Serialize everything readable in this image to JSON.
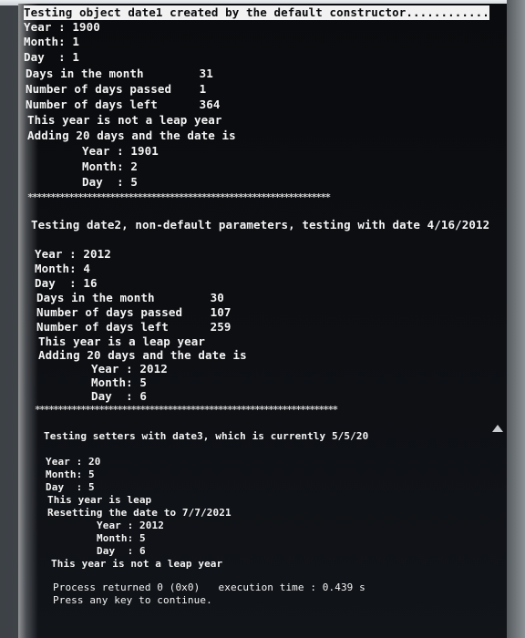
{
  "console": {
    "section1": {
      "header": "Testing object date1 created by the default constructor............",
      "year": "Year : 1900",
      "month": "Month: 1",
      "day": "Day  : 1",
      "days_in_month": "Days in the month        31",
      "days_passed": "Number of days passed    1",
      "days_left": "Number of days left      364",
      "leap": "This year is not a leap year",
      "adding": "Adding 20 days and the date is",
      "new_year": "Year : 1901",
      "new_month": "Month: 2",
      "new_day": "Day  : 5"
    },
    "separator": "******************************************************************",
    "section2": {
      "header": "Testing date2, non-default parameters, testing with date 4/16/2012",
      "year": "Year : 2012",
      "month": "Month: 4",
      "day": "Day  : 16",
      "days_in_month": "Days in the month        30",
      "days_passed": "Number of days passed    107",
      "days_left": "Number of days left      259",
      "leap": "This year is a leap year",
      "adding": "Adding 20 days and the date is",
      "new_year": "Year : 2012",
      "new_month": "Month: 5",
      "new_day": "Day  : 6"
    },
    "section3": {
      "header": "Testing setters with date3, which is currently 5/5/20",
      "year": "Year : 20",
      "month": "Month: 5",
      "day": "Day  : 5",
      "leap": "This year is leap",
      "resetting": "Resetting the date to 7/7/2021",
      "new_year": "Year : 2012",
      "new_month": "Month: 5",
      "new_day": "Day  : 6",
      "leap2": "This year is not a leap year"
    },
    "footer": {
      "process": "Process returned 0 (0x0)   execution time : 0.439 s",
      "press": "Press any key to continue."
    }
  }
}
